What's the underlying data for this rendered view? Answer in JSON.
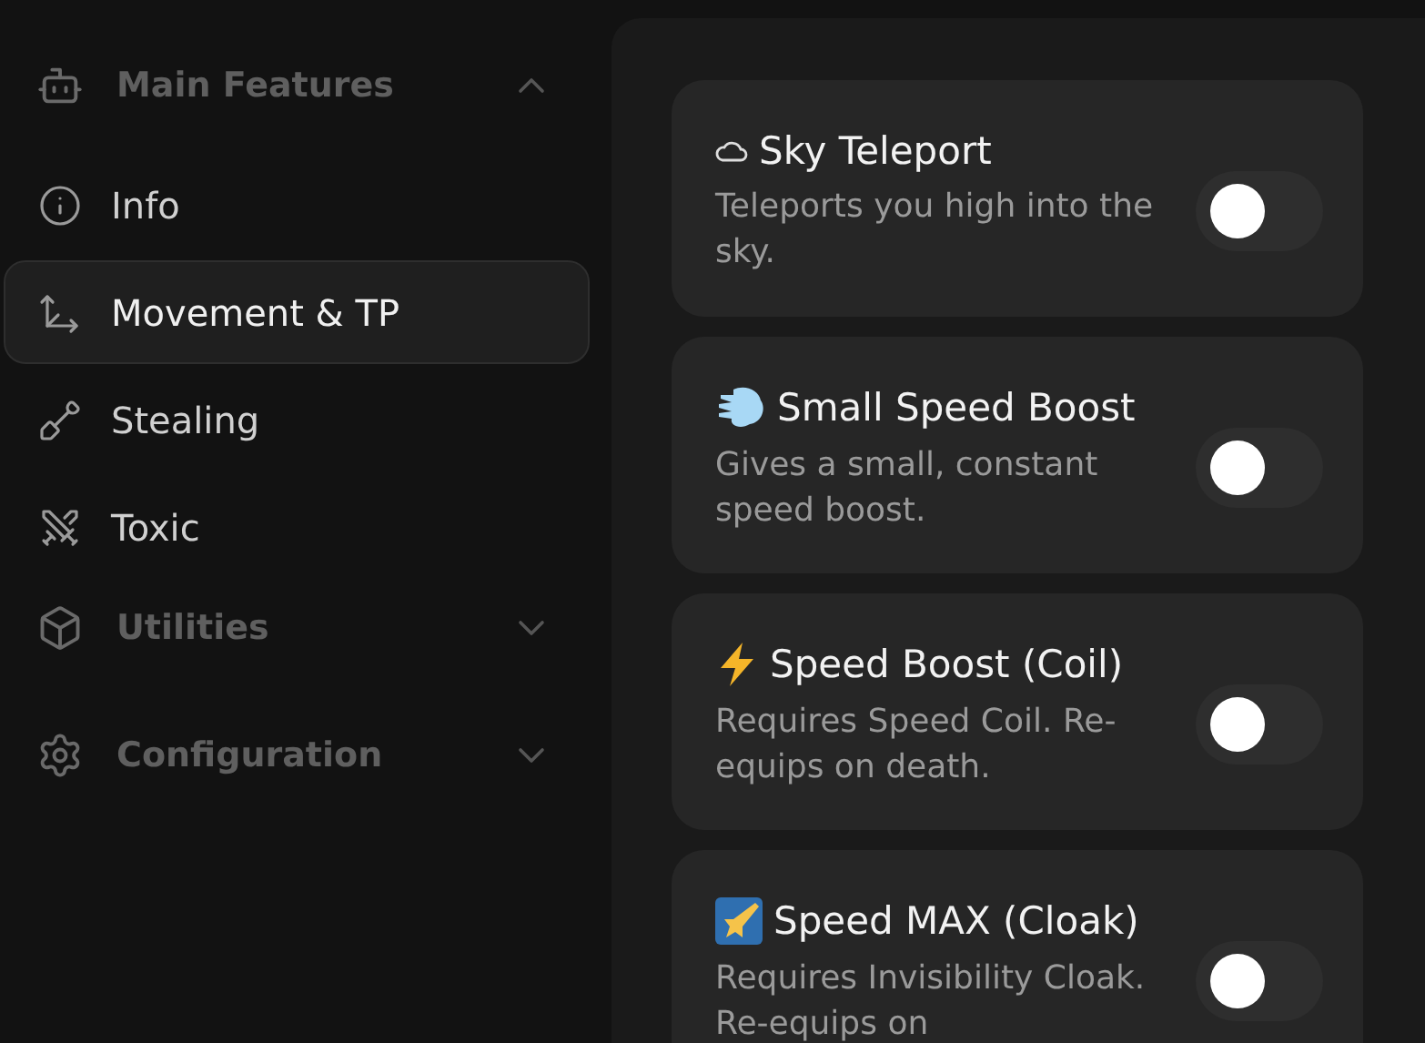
{
  "sidebar": {
    "groups": [
      {
        "label": "Main Features",
        "expanded": true,
        "items": [
          {
            "label": "Info",
            "selected": false
          },
          {
            "label": "Movement & TP",
            "selected": true
          },
          {
            "label": "Stealing",
            "selected": false
          },
          {
            "label": "Toxic",
            "selected": false
          }
        ]
      },
      {
        "label": "Utilities",
        "expanded": false
      },
      {
        "label": "Configuration",
        "expanded": false
      }
    ]
  },
  "features": [
    {
      "title": "Sky Teleport",
      "description": "Teleports you high into the sky.",
      "on": false
    },
    {
      "title": "Small Speed Boost",
      "description": "Gives a small, constant speed boost.",
      "on": false
    },
    {
      "title": "Speed Boost (Coil)",
      "description": "Requires Speed Coil. Re-equips on death.",
      "on": false
    },
    {
      "title": "Speed MAX (Cloak)",
      "description": "Requires Invisibility Cloak. Re-equips on",
      "on": false
    }
  ]
}
